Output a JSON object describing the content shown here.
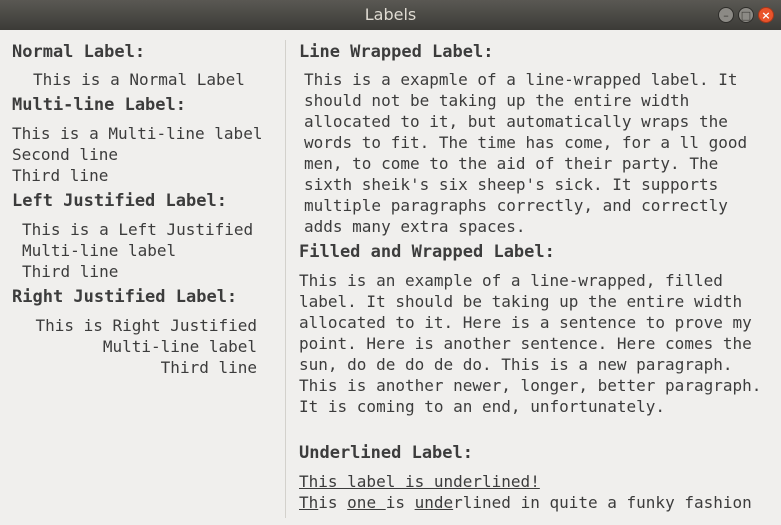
{
  "window": {
    "title": "Labels",
    "controls": {
      "minimize": "–",
      "maximize": "□",
      "close": "×"
    }
  },
  "left": {
    "normal_heading": "Normal Label:",
    "normal_text": "This is a Normal Label",
    "multiline_heading": "Multi-line Label:",
    "multiline_lines": [
      "This is a Multi-line label",
      "Second line",
      "Third line"
    ],
    "leftjust_heading": "Left Justified Label:",
    "leftjust_lines": [
      "This is a Left Justified",
      "Multi-line label",
      "Third line"
    ],
    "rightjust_heading": "Right Justified Label:",
    "rightjust_lines": [
      "This is Right Justified",
      "Multi-line label",
      "Third line"
    ]
  },
  "right": {
    "wrapped_heading": "Line Wrapped Label:",
    "wrapped_text": "This is a exapmle of a line-wrapped label. It should not be taking up the entire width allocated to it, but automatically wraps the words to fit. The time has come, for a ll good men, to come to the aid of their party. The sixth sheik's six sheep's sick. It supports multiple paragraphs correctly, and correctly adds many extra spaces.",
    "filled_heading": "Filled and Wrapped Label:",
    "filled_para1": "This is an example of a line-wrapped, filled label. It should be taking up the entire width allocated to it. Here is a sentence to prove my point. Here is another sentence. Here comes the sun, do de do de do.",
    "filled_para2": "This is a new paragraph.",
    "filled_para3": "This is another newer, longer, better paragraph. It is coming to an end, unfortunately.",
    "underlined_heading": "Underlined Label:",
    "underline_line1": "This label is underlined!",
    "funky_parts": [
      "Th",
      "is ",
      "one ",
      "is ",
      "un",
      "de",
      "rlined in quite a funky fashion"
    ]
  }
}
